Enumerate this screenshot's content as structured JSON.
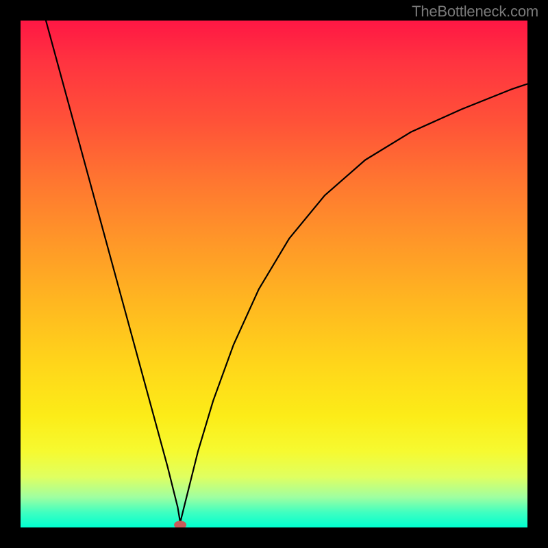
{
  "watermark": "TheBottleneck.com",
  "chart_data": {
    "type": "line",
    "title": "",
    "xlabel": "",
    "ylabel": "",
    "xlim": [
      0,
      100
    ],
    "ylim": [
      0,
      100
    ],
    "grid": false,
    "legend": false,
    "marker": {
      "x": 31.5,
      "y": 0.5,
      "color": "#c85a5a",
      "shape": "oval"
    },
    "series": [
      {
        "name": "curve",
        "color": "#000000",
        "x": [
          5,
          8,
          11,
          14,
          17,
          20,
          23,
          26,
          29,
          31,
          31.5,
          32,
          33,
          35,
          38,
          42,
          47,
          53,
          60,
          68,
          77,
          87,
          97,
          100
        ],
        "y": [
          100,
          89,
          78,
          67,
          56,
          45,
          34,
          23,
          12,
          4,
          1,
          3,
          7,
          15,
          25,
          36,
          47,
          57,
          65.5,
          72.5,
          78,
          82.5,
          86.5,
          87.5
        ]
      }
    ]
  }
}
